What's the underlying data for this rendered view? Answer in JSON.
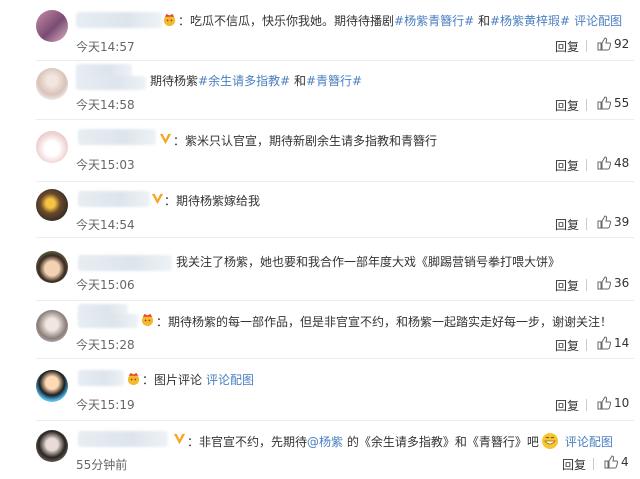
{
  "comments": [
    {
      "badge": "crown-emoji",
      "before": "：吃瓜不信瓜，快乐你我她。期待待播剧",
      "tag1": "#杨紫青簪行#",
      "mid": " 和",
      "tag2": "#杨紫黄梓瑕#",
      "tail": "评论配图",
      "time": "今天14:57",
      "reply": "回复",
      "likes": "92"
    },
    {
      "before": "期待杨紫",
      "tag1": "#余生请多指教#",
      "mid": " 和",
      "tag2": "#青簪行#",
      "time": "今天14:58",
      "reply": "回复",
      "likes": "55"
    },
    {
      "badge": "verified-v",
      "before": "：紫米只认官宣，期待新剧余生请多指教和青簪行",
      "time": "今天15:03",
      "reply": "回复",
      "likes": "48"
    },
    {
      "badge": "verified-v",
      "before": "：期待杨紫嫁给我",
      "time": "今天14:54",
      "reply": "回复",
      "likes": "39"
    },
    {
      "before": "我关注了杨紫，她也要和我合作一部年度大戏《脚踢营销号拳打喂大饼》",
      "time": "今天15:06",
      "reply": "回复",
      "likes": "36"
    },
    {
      "badge": "crown-emoji",
      "before": "：期待杨紫的每一部作品，但是非官宣不约，和杨紫一起踏实走好每一步，谢谢关注！",
      "time": "今天15:28",
      "reply": "回复",
      "likes": "14"
    },
    {
      "badge": "crown-emoji",
      "before": "：图片评论",
      "tail": "评论配图",
      "time": "今天15:19",
      "reply": "回复",
      "likes": "10"
    },
    {
      "badge": "verified-v",
      "before": "：非官宣不约，先期待",
      "mention": "@杨紫",
      "mid2": " 的《余生请多指教》和《青簪行》吧",
      "tail": "评论配图",
      "time": "55分钟前",
      "reply": "回复",
      "likes": "4"
    }
  ],
  "colors": {
    "link": "#4a7fc0",
    "verified": "#f5a623",
    "text": "#333333",
    "meta": "#666666"
  }
}
